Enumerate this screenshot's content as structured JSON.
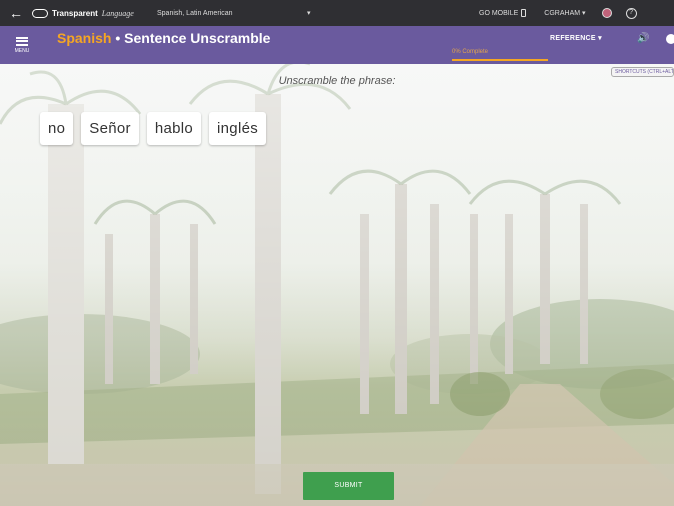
{
  "topbar": {
    "brand": "Transparent",
    "brand_script": "Language",
    "language": "Spanish, Latin American",
    "go_mobile": "GO MOBILE",
    "user": "CGRAHAM ▾"
  },
  "titlebar": {
    "menu_label": "MENU",
    "title_lang": "Spanish",
    "title_sep": " • ",
    "title_activity": "Sentence Unscramble",
    "progress": "0% Complete",
    "reference": "REFERENCE ▾",
    "shortcuts": "SHORTCUTS (CTRL+ALT)"
  },
  "main": {
    "instruction": "Unscramble the phrase:",
    "tiles": [
      "no",
      "Señor",
      "hablo",
      "inglés"
    ],
    "submit": "SUBMIT"
  },
  "colors": {
    "topbar": "#2f2f33",
    "titlebar": "#6a5a9e",
    "accent": "#f5a623",
    "submit": "#3f9f4e"
  }
}
